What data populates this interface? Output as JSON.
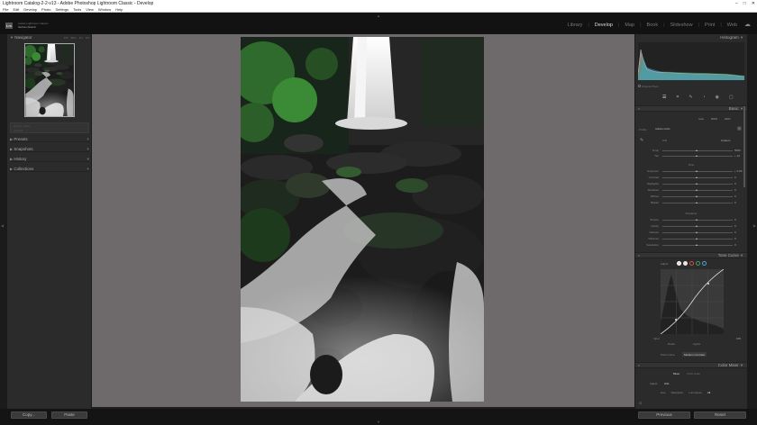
{
  "window": {
    "title": "Lightroom Catalog-2-2-v13 - Adobe Photoshop Lightroom Classic - Develop",
    "controls": [
      "–",
      "□",
      "✕"
    ]
  },
  "menu": [
    "File",
    "Edit",
    "Develop",
    "Photo",
    "Settings",
    "Tools",
    "View",
    "Window",
    "Help"
  ],
  "identity": {
    "logo": "Lrc",
    "line1": "Adobe Lightroom Classic",
    "line2": "Serhan Altundi"
  },
  "modules": [
    "Library",
    "Develop",
    "Map",
    "Book",
    "Slideshow",
    "Print",
    "Web"
  ],
  "active_module": "Develop",
  "left": {
    "navigator": {
      "label": "Navigator",
      "zoom": [
        "FIT",
        "FILL",
        "1:1",
        "3:1"
      ]
    },
    "panels": [
      {
        "label": "Presets"
      },
      {
        "label": "Snapshots"
      },
      {
        "label": "History"
      },
      {
        "label": "Collections"
      }
    ],
    "preset_box": {
      "line1": "Preset : None",
      "line2": "Amount"
    },
    "copy_btn": "Copy...",
    "paste_btn": "Paste"
  },
  "right": {
    "histogram": {
      "label": "Histogram",
      "info": "Original Photo"
    },
    "basic": {
      "label": "Basic",
      "auto_row": [
        "Auto",
        "B&W",
        "HDR"
      ],
      "profile_label": "Profile",
      "profile_value": "Adobe Color",
      "wb_label": "WB",
      "wb_value": "Custom",
      "tone_label": "Tone",
      "presence_label": "Presence",
      "sliders1": [
        {
          "label": "Temp",
          "value": "5000"
        },
        {
          "label": "Tint",
          "value": "+ 10"
        }
      ],
      "sliders2": [
        {
          "label": "Exposure",
          "value": "+ 0.00"
        },
        {
          "label": "Contrast",
          "value": "0"
        },
        {
          "label": "Highlights",
          "value": "0"
        },
        {
          "label": "Shadows",
          "value": "0"
        },
        {
          "label": "Whites",
          "value": "0"
        },
        {
          "label": "Blacks",
          "value": "0"
        }
      ],
      "sliders3": [
        {
          "label": "Texture",
          "value": "0"
        },
        {
          "label": "Clarity",
          "value": "0"
        },
        {
          "label": "Dehaze",
          "value": "0"
        },
        {
          "label": "Vibrance",
          "value": "0"
        },
        {
          "label": "Saturation",
          "value": "0"
        }
      ]
    },
    "tone_curve": {
      "label": "Tone Curve",
      "adjust_label": "Adjust",
      "point_curve_label": "Point Curve",
      "point_curve_value": "Medium Contrast",
      "input_value": "100",
      "lights": "Lights",
      "darks": "Darks"
    },
    "color_mixer": {
      "label": "Color Mixer",
      "tabs": [
        "Mixer",
        "Point Color"
      ],
      "adjust_label": "Adjust",
      "adjust_value": "HSL",
      "sub": [
        "Hue",
        "Saturation",
        "Luminance",
        "All"
      ]
    },
    "previous_btn": "Previous",
    "reset_btn": "Reset"
  },
  "toolbar": {
    "softproof": "Soft Proofing"
  },
  "colors": {
    "accent": "#c5c5c5",
    "histogram_blue": "#4ea0d8",
    "histogram_green": "#3aa05a"
  }
}
